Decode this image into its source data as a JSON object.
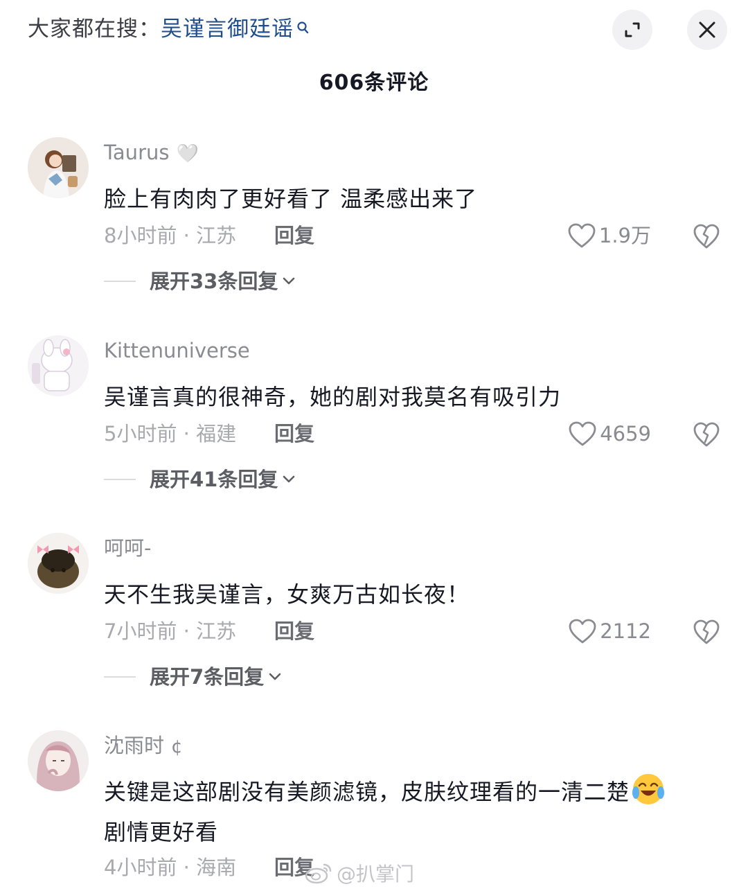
{
  "header": {
    "search_prefix": "大家都在搜：",
    "search_keyword": "吴谨言御廷谣",
    "comment_count": "606条评论"
  },
  "comments": [
    {
      "username": "Taurus",
      "badge": "🤍",
      "text": "脸上有肉肉了更好看了 温柔感出来了",
      "time_location": "8小时前 · 江苏",
      "reply": "回复",
      "likes": "1.9万",
      "expand": "展开33条回复"
    },
    {
      "username": "Kittenuniverse",
      "text": "吴谨言真的很神奇，她的剧对我莫名有吸引力",
      "time_location": "5小时前 · 福建",
      "reply": "回复",
      "likes": "4659",
      "expand": "展开41条回复"
    },
    {
      "username": "呵呵-",
      "text": "天不生我吴谨言，女爽万古如长夜！",
      "time_location": "7小时前 · 江苏",
      "reply": "回复",
      "likes": "2112",
      "expand": "展开7条回复"
    },
    {
      "username": "沈雨时",
      "badge": "¢",
      "text_line1": "关键是这部剧没有美颜滤镜，皮肤纹理看的一清二楚",
      "text_line2": "剧情更好看",
      "time_location": "4小时前 · 海南",
      "reply": "回复"
    }
  ],
  "watermark": "@扒掌门",
  "colors": {
    "keyword_blue": "#1f4e8f",
    "secondary_gray": "#a8a9ad",
    "text_dark": "#161823"
  },
  "icons": [
    "search-icon",
    "expand-icon",
    "close-icon",
    "heart-icon",
    "broken-heart-icon",
    "chevron-down-icon",
    "crying-laughing-emoji",
    "weibo-logo-icon"
  ]
}
